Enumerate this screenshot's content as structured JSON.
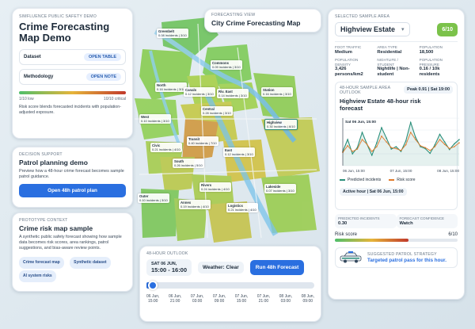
{
  "left_panel": {
    "demo_label": "Simfluence public safety demo",
    "title": "Crime Forecasting Map Demo",
    "dataset_label": "Dataset",
    "dataset_button": "OPEN TABLE",
    "methodology_label": "Methodology",
    "methodology_button": "OPEN NOTE",
    "scale_low": "1/10 low",
    "scale_high": "10/10 critical",
    "scale_note": "Risk score blends forecasted incidents with population-adjusted exposure."
  },
  "decision_card": {
    "label": "Decision support",
    "title": "Patrol planning demo",
    "text": "Preview how a 48-hour crime forecast becomes sample patrol guidance.",
    "button": "Open 48h patrol plan"
  },
  "prototype_card": {
    "label": "Prototype context",
    "title": "Crime risk map sample",
    "text": "A synthetic public safety forecast showing how sample data becomes risk scores, area rankings, patrol suggestions, and bias-aware review points.",
    "tags": [
      "Crime forecast map",
      "Synthetic dataset",
      "AI system risks"
    ]
  },
  "forecast_view": {
    "label": "Forecasting view",
    "title": "City Crime Forecasting Map"
  },
  "outlook": {
    "label": "48-hour outlook",
    "date": "SAT 06 JUN,",
    "time": "15:00 - 16:00",
    "weather": "Weather: Clear",
    "run_button": "Run 48h Forecast",
    "progress": 0.02,
    "ticks": [
      [
        "06 Jun,",
        "15:00"
      ],
      [
        "06 Jun,",
        "21:00"
      ],
      [
        "07 Jun,",
        "03:00"
      ],
      [
        "07 Jun,",
        "09:00"
      ],
      [
        "07 Jun,",
        "15:00"
      ],
      [
        "07 Jun,",
        "21:00"
      ],
      [
        "08 Jun,",
        "03:00"
      ],
      [
        "08 Jun,",
        "09:00"
      ]
    ]
  },
  "areas": [
    {
      "name": "Greenbelt",
      "text": "0.08 incidents | 3/10"
    },
    {
      "name": "Commons",
      "text": "0.09 incidents | 3/10"
    },
    {
      "name": "North",
      "text": "0.16 incidents | 3/10"
    },
    {
      "name": "Canals",
      "text": "0.12 incidents | 3/10"
    },
    {
      "name": "Riv. East",
      "text": "0.14 incidents | 3/10"
    },
    {
      "name": "Station",
      "text": "0.16 incidents | 3/10"
    },
    {
      "name": "West",
      "text": "0.10 incidents | 3/10"
    },
    {
      "name": "Central",
      "text": "0.28 incidents | 3/10"
    },
    {
      "name": "Highview",
      "text": "0.30 incidents | 6/10"
    },
    {
      "name": "Transit",
      "text": "0.40 incidents | 7/10"
    },
    {
      "name": "Civic",
      "text": "0.21 incidents | 4/10"
    },
    {
      "name": "East",
      "text": "0.12 incidents | 3/10"
    },
    {
      "name": "South",
      "text": "0.26 incidents | 5/10"
    },
    {
      "name": "Rivers",
      "text": "0.24 incidents | 4/10"
    },
    {
      "name": "Lakeside",
      "text": "0.07 incidents | 3/10"
    },
    {
      "name": "Outer",
      "text": "0.10 incidents | 3/10"
    },
    {
      "name": "Annex",
      "text": "0.19 incidents | 4/10"
    },
    {
      "name": "Logistics",
      "text": "0.21 incidents | 4/10"
    }
  ],
  "right_panel": {
    "label": "Selected sample area",
    "area_name": "Highview Estate",
    "score_badge": "6/10",
    "stats": [
      {
        "label": "Foot traffic",
        "value": "Medium"
      },
      {
        "label": "Area type",
        "value": "Residential"
      },
      {
        "label": "Population",
        "value": "18,500"
      },
      {
        "label": "Population density",
        "value": "3,426 persons/km2"
      },
      {
        "label": "Nightlife / student",
        "value": "Nightlife | Non-student"
      },
      {
        "label": "Population pressure",
        "value": "0.16 / 10k residents"
      }
    ],
    "chart_label": "48-hour sample area outlook",
    "chart_peak": "Peak 0.91 | Sat 19:00",
    "chart_title": "Highview Estate 48-hour risk forecast",
    "tooltip": "Sat 06 Jun, 15:00",
    "x_ticks": [
      "06 Jun, 15:00",
      "07 Jun, 15:00",
      "08 Jun, 15:00"
    ],
    "legend_predicted": "Predicted incidents",
    "legend_risk": "Risk score",
    "active_hour": "Active hour | Sat 06 Jun, 15:00",
    "predicted_label": "Predicted incidents",
    "predicted_value": "0.30",
    "confidence_label": "Forecast confidence",
    "confidence_value": "Watch",
    "risk_label": "Risk score",
    "risk_value": "6/10",
    "risk_fraction": 0.6,
    "strategy_label": "Suggested patrol strategy",
    "strategy_text": "Targeted patrol pass for this hour."
  },
  "chart_data": {
    "type": "line",
    "title": "Highview Estate 48-hour risk forecast",
    "x": [
      "06 Jun, 15:00",
      "07 Jun, 15:00",
      "08 Jun, 15:00"
    ],
    "series": [
      {
        "name": "Predicted incidents",
        "values": [
          0.3,
          0.55,
          0.25,
          0.38,
          0.7,
          0.45,
          0.22,
          0.48,
          0.8,
          0.58,
          0.35,
          0.4,
          0.3,
          0.52,
          0.91,
          0.6,
          0.4,
          0.36,
          0.26,
          0.44,
          0.66,
          0.5,
          0.34,
          0.46,
          0.55
        ]
      },
      {
        "name": "Risk score",
        "values": [
          0.28,
          0.42,
          0.3,
          0.35,
          0.55,
          0.45,
          0.3,
          0.4,
          0.62,
          0.5,
          0.38,
          0.36,
          0.32,
          0.44,
          0.7,
          0.55,
          0.42,
          0.38,
          0.32,
          0.4,
          0.55,
          0.45,
          0.36,
          0.4,
          0.48
        ]
      }
    ],
    "colors": {
      "predicted": "#2a8f7a",
      "risk": "#e07a2a"
    }
  },
  "colors": {
    "accent": "#2a6fe0",
    "badge": "#7bc24a",
    "scale_low": "#4fbf6a",
    "scale_mid": "#e6b43a",
    "scale_high": "#c0392b"
  }
}
